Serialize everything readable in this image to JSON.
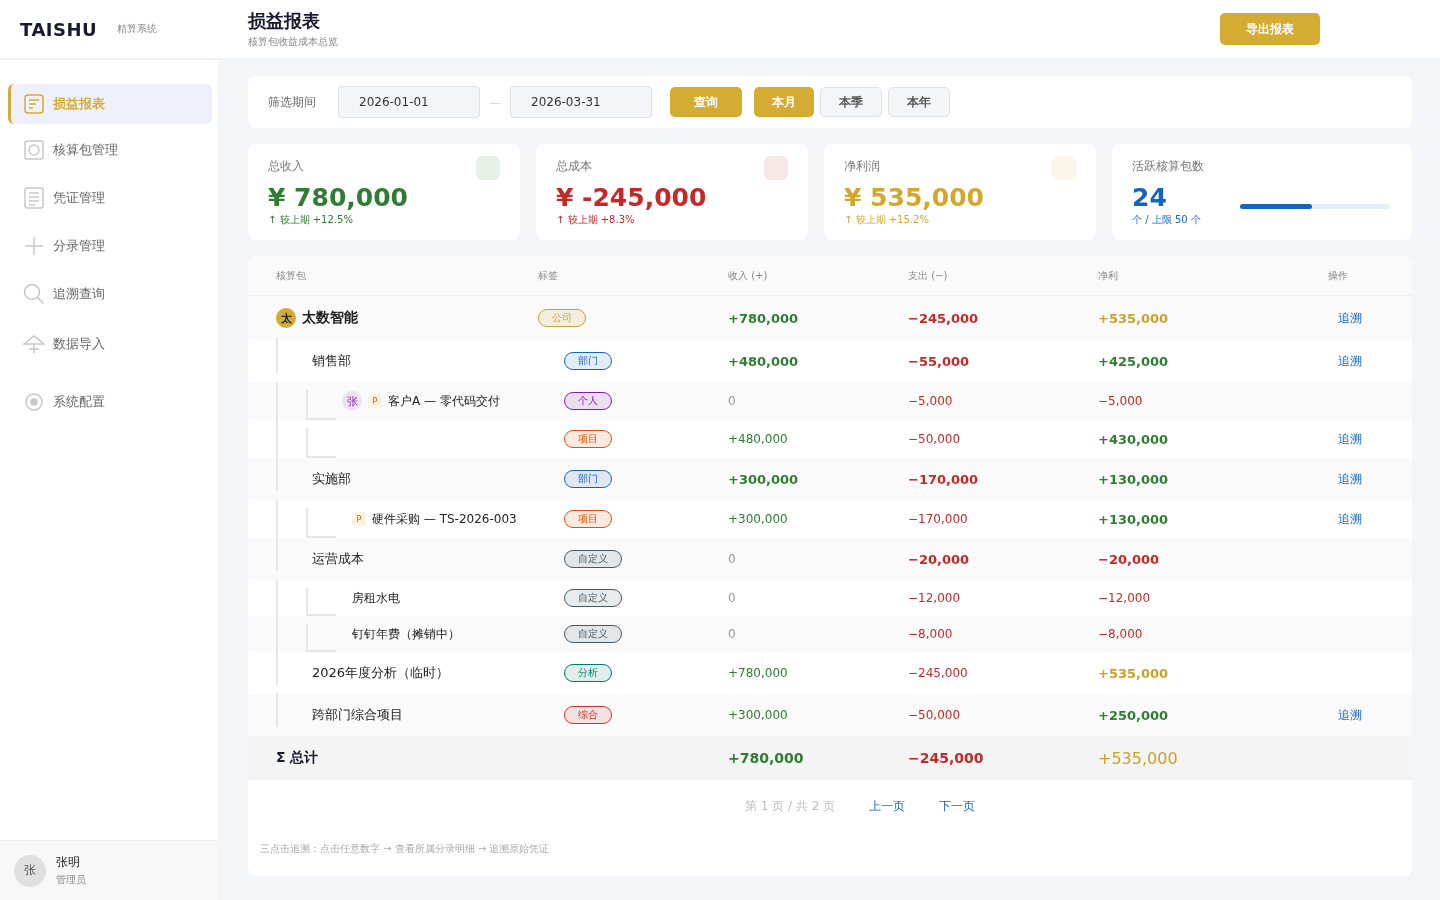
{
  "brand": {
    "logo": "TAISHU",
    "subtitle": "精算系统"
  },
  "sidebar": {
    "items": [
      {
        "label": "损益报表",
        "selected": true
      },
      {
        "label": "核算包管理",
        "selected": false
      },
      {
        "label": "凭证管理",
        "selected": false
      },
      {
        "label": "分录管理",
        "selected": false
      },
      {
        "label": "追溯查询",
        "selected": false
      },
      {
        "label": "数据导入",
        "selected": false
      },
      {
        "label": "系统配置",
        "selected": false
      }
    ],
    "user": {
      "avatar": "张",
      "name": "张明",
      "role": "管理员"
    }
  },
  "header": {
    "title": "损益报表",
    "subtitle": "核算包收益成本总览",
    "export_button": "导出报表"
  },
  "filter": {
    "label": "筛选期间",
    "start": "2026-01-01",
    "separator": "—",
    "end": "2026-03-31",
    "query_button": "查询",
    "periods": [
      {
        "label": "本月",
        "selected": true
      },
      {
        "label": "本季",
        "selected": false
      },
      {
        "label": "本年",
        "selected": false
      }
    ]
  },
  "stats": [
    {
      "kind": "money",
      "label": "总收入",
      "value": "¥ 780,000",
      "change": "↑ 较上期 +12.5%",
      "color": "#2e7d32"
    },
    {
      "kind": "money",
      "label": "总成本",
      "value": "¥ -245,000",
      "change": "↑ 较上期 +8.3%",
      "color": "#c62828"
    },
    {
      "kind": "money",
      "label": "净利润",
      "value": "¥ 535,000",
      "change": "↑ 较上期 +15.2%",
      "color": "#d4a72c"
    },
    {
      "kind": "meter",
      "label": "活跃核算包数",
      "value": "24",
      "change": "个 / 上限 50 个",
      "color": "#1565c0",
      "level": 0.48
    }
  ],
  "table": {
    "columns": [
      "核算包",
      "标签",
      "收入 (+)",
      "支出 (−)",
      "净利",
      "操作"
    ],
    "rows": [
      {
        "name": "太数智能",
        "mark": "太",
        "tag": "公司",
        "color": "#c9a227",
        "income": "+780,000",
        "expense": "−245,000",
        "net": "+535,000",
        "highlight": true,
        "strong": true,
        "action": "追溯",
        "children": [
          {
            "name": "销售部",
            "tag": "部门",
            "color": "#1565c0",
            "income": "+480,000",
            "expense": "−55,000",
            "net": "+425,000",
            "highlight": false,
            "strong": true,
            "action": "追溯",
            "children": [
              {
                "avatar": "张",
                "badge": "P",
                "name": "客户A — 零代码交付",
                "tag": "个人",
                "color": "#7b1fa2",
                "income": "0",
                "expense": "−5,000",
                "net": "−5,000",
                "highlight": false,
                "strong": false
              },
              {
                "tag": "项目",
                "color": "#e65100",
                "income": "+480,000",
                "expense": "−50,000",
                "net": "+430,000",
                "highlight": false,
                "strong": false,
                "action": "追溯"
              }
            ]
          },
          {
            "name": "实施部",
            "tag": "部门",
            "color": "#1565c0",
            "income": "+300,000",
            "expense": "−170,000",
            "net": "+130,000",
            "highlight": false,
            "strong": true,
            "action": "追溯",
            "children": [
              {
                "badge": "P",
                "name": "硬件采购 — TS-2026-003",
                "tag": "项目",
                "color": "#e65100",
                "income": "+300,000",
                "expense": "−170,000",
                "net": "+130,000",
                "highlight": false,
                "strong": false,
                "action": "追溯"
              }
            ]
          },
          {
            "name": "运营成本",
            "tag": "自定义",
            "color": "#455a64",
            "income": "0",
            "expense": "−20,000",
            "net": "−20,000",
            "highlight": false,
            "strong": true,
            "children": [
              {
                "name": "房租水电",
                "tag": "自定义",
                "color": "#455a64",
                "income": "0",
                "expense": "−12,000",
                "net": "−12,000",
                "highlight": false,
                "strong": false
              },
              {
                "name": "钉钉年费（摊销中）",
                "tag": "自定义",
                "color": "#455a64",
                "income": "0",
                "expense": "−8,000",
                "net": "−8,000",
                "highlight": false,
                "strong": false
              }
            ]
          },
          {
            "name": "2026年度分析（临时）",
            "tag": "分析",
            "color": "#00796b",
            "income": "+780,000",
            "expense": "−245,000",
            "net": "+535,000",
            "highlight": true,
            "strong": false
          },
          {
            "name": "跨部门综合项目",
            "tag": "综合",
            "color": "#d32f2f",
            "income": "+300,000",
            "expense": "−50,000",
            "net": "+250,000",
            "highlight": false,
            "strong": false,
            "action": "追溯"
          }
        ]
      }
    ],
    "total": {
      "label": "Σ 总计",
      "income": "+780,000",
      "expense": "−245,000",
      "net": "+535,000"
    }
  },
  "pagination": {
    "info": "第 1 页 / 共 2 页",
    "prev": "上一页",
    "next": "下一页"
  },
  "note": "三点击追溯：点击任意数字 → 查看所属分录明细 → 追溯原始凭证"
}
